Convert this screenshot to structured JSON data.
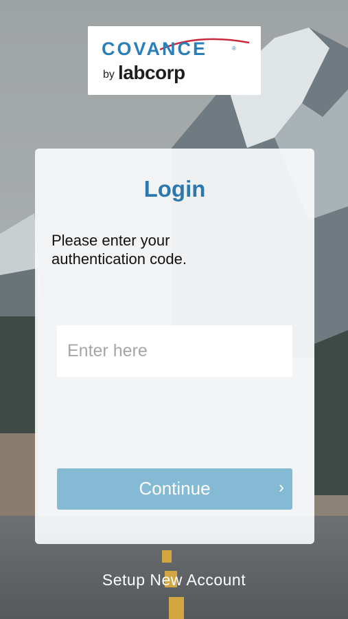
{
  "logo": {
    "brand": "COVANCE",
    "by": "by",
    "parent": "labcorp",
    "registered": "®"
  },
  "login": {
    "title": "Login",
    "prompt": "Please enter your authentication code.",
    "input_placeholder": "Enter here",
    "input_value": "",
    "continue_label": "Continue",
    "continue_icon": "chevron-right-icon"
  },
  "footer": {
    "setup_link": "Setup New Account"
  },
  "colors": {
    "accent": "#2a78ad",
    "button": "#85bad5",
    "card": "#f8f9fa"
  }
}
